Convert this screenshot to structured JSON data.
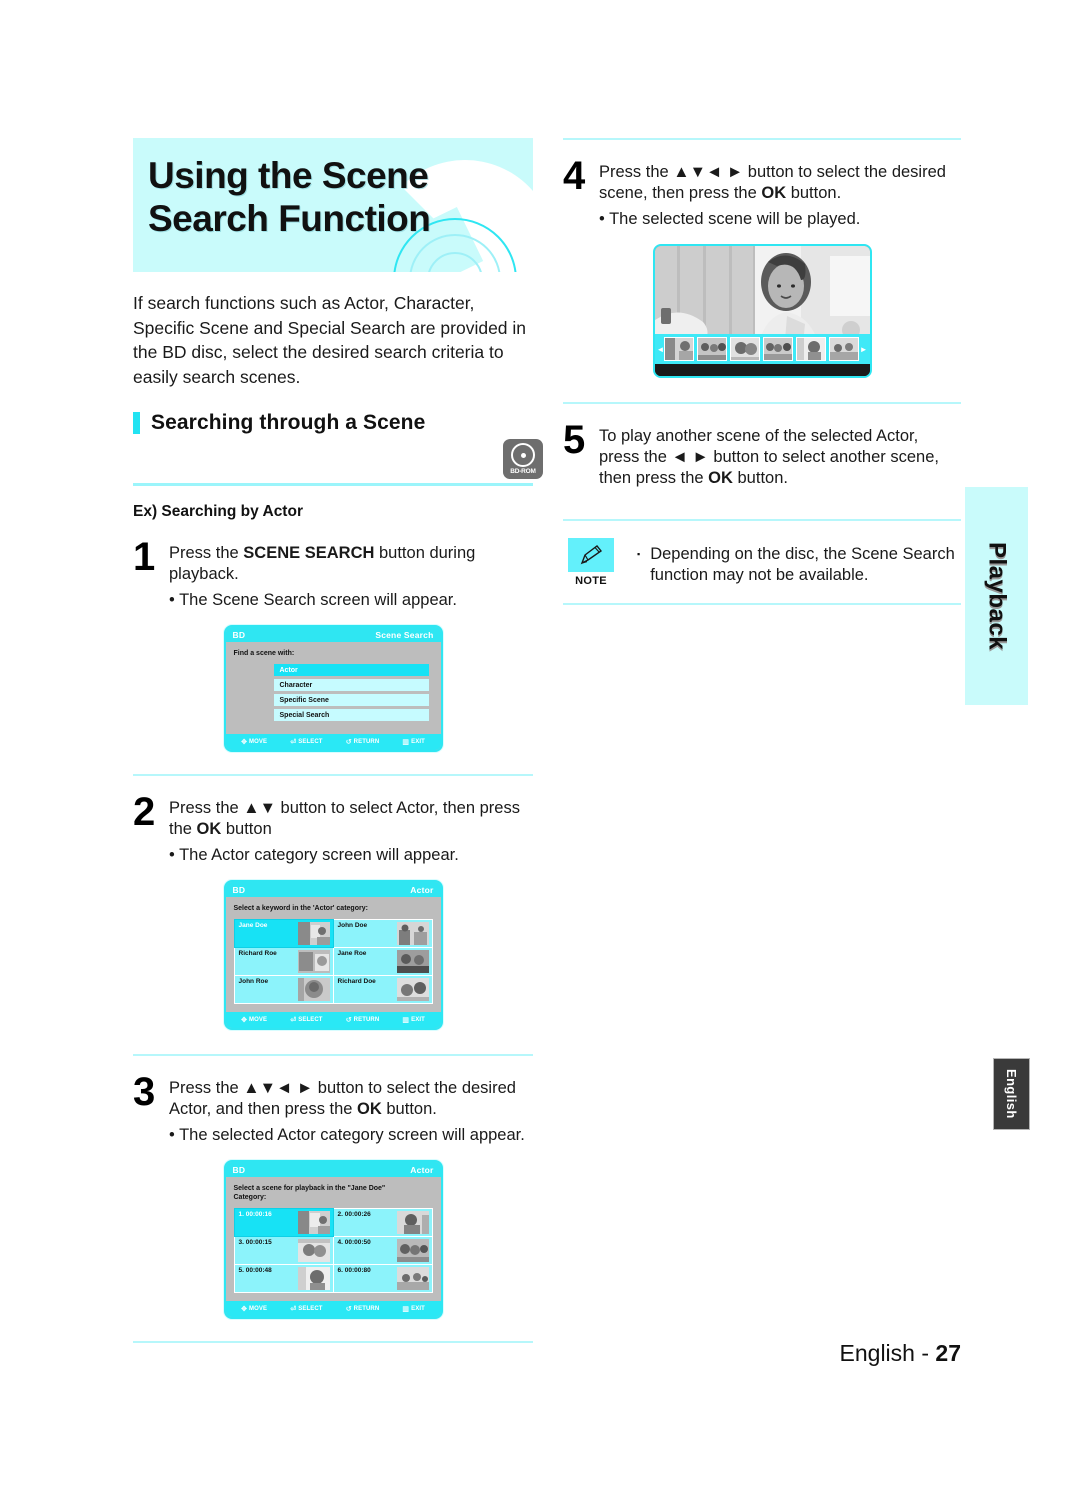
{
  "header": {
    "title_line1": "Using the Scene",
    "title_line2": "Search Function",
    "disc_icon": "bd-disc-graphic"
  },
  "intro": "If search functions such as Actor, Character, Specific Scene and Special Search are provided in the BD disc, select the desired search criteria to easily search scenes.",
  "section": {
    "title": "Searching through a Scene",
    "media_badge": "BD-ROM"
  },
  "example_label": "Ex) Searching by Actor",
  "steps": [
    {
      "num": "1",
      "line1_pre": "Press the ",
      "line1_bold": "SCENE SEARCH",
      "line1_post": " button during playback.",
      "sub": "• The Scene Search screen will appear."
    },
    {
      "num": "2",
      "line1_pre": "Press the ",
      "line1_bold": "▲▼",
      "line1_post": " button to select Actor, then press the",
      "line2_bold": "OK",
      "line2_post": " button",
      "sub": "• The Actor category screen will appear."
    },
    {
      "num": "3",
      "line1_pre": "Press the ",
      "line1_bold": "▲▼◄ ►",
      "line1_post": " button to select the desired Actor,",
      "line2_pre": "and then press the ",
      "line2_bold": "OK",
      "line2_post": " button.",
      "sub": "• The selected Actor category screen will appear."
    },
    {
      "num": "4",
      "line1_pre": "Press the ",
      "line1_bold": "▲▼◄ ►",
      "line1_post": " button to select the desired",
      "line2_pre": "scene, then press the ",
      "line2_bold": "OK",
      "line2_post": " button.",
      "sub": "• The selected scene will be played."
    },
    {
      "num": "5",
      "line1_pre": "To play another scene of the selected Actor, press",
      "line2_pre": "the ",
      "line2_bold": "◄ ►",
      "line2_post": " button to select another scene, then press",
      "line3_pre": "the ",
      "line3_bold": "OK",
      "line3_post": " button."
    }
  ],
  "osd_common": {
    "nav": [
      {
        "icon": "dpad-icon",
        "label": "MOVE"
      },
      {
        "icon": "enter-icon",
        "label": "SELECT"
      },
      {
        "icon": "return-icon",
        "label": "RETURN"
      },
      {
        "icon": "exit-icon",
        "label": "EXIT"
      }
    ]
  },
  "osd_scene_search": {
    "left_label": "BD",
    "right_label": "Scene Search",
    "prompt": "Find a scene with:",
    "items": [
      {
        "label": "Actor",
        "selected": true
      },
      {
        "label": "Character",
        "selected": false
      },
      {
        "label": "Specific Scene",
        "selected": false
      },
      {
        "label": "Special Search",
        "selected": false
      }
    ]
  },
  "osd_actor_category": {
    "left_label": "BD",
    "right_label": "Actor",
    "prompt": "Select a keyword in the 'Actor' category:",
    "cells": [
      {
        "label": "Jane Doe",
        "selected": true
      },
      {
        "label": "John Doe",
        "selected": false
      },
      {
        "label": "Richard Roe",
        "selected": false
      },
      {
        "label": "Jane Roe",
        "selected": false
      },
      {
        "label": "John Roe",
        "selected": false
      },
      {
        "label": "Richard Doe",
        "selected": false
      }
    ]
  },
  "osd_actor_scenes": {
    "left_label": "BD",
    "right_label": "Actor",
    "prompt_line1": "Select a scene for playback in the \"Jane Doe\"",
    "prompt_line2": "Category:",
    "cells": [
      {
        "label": "1. 00:00:16",
        "selected": true
      },
      {
        "label": "2. 00:00:26",
        "selected": false
      },
      {
        "label": "3. 00:00:15",
        "selected": false
      },
      {
        "label": "4. 00:00:50",
        "selected": false
      },
      {
        "label": "5. 00:00:48",
        "selected": false
      },
      {
        "label": "6. 00:00:80",
        "selected": false
      }
    ]
  },
  "playback_photo": {
    "name": "scene-playback-screenshot",
    "filmstrip_count": 6,
    "left_arrow": "◄",
    "right_arrow": "►"
  },
  "note": {
    "label": "NOTE",
    "icon": "pencil-icon",
    "bullet": "▪",
    "text": "Depending on the disc, the Scene Search function may not be available."
  },
  "side_tabs": {
    "chapter": "Playback",
    "language": "English"
  },
  "footer": {
    "language": "English",
    "dash": " - ",
    "page": "27"
  },
  "colors": {
    "accent_cyan": "#2fe6f2",
    "pale_cyan": "#c9fbfb",
    "osd_gray": "#bdbdbd",
    "dark_tab": "#3a3a3a"
  }
}
